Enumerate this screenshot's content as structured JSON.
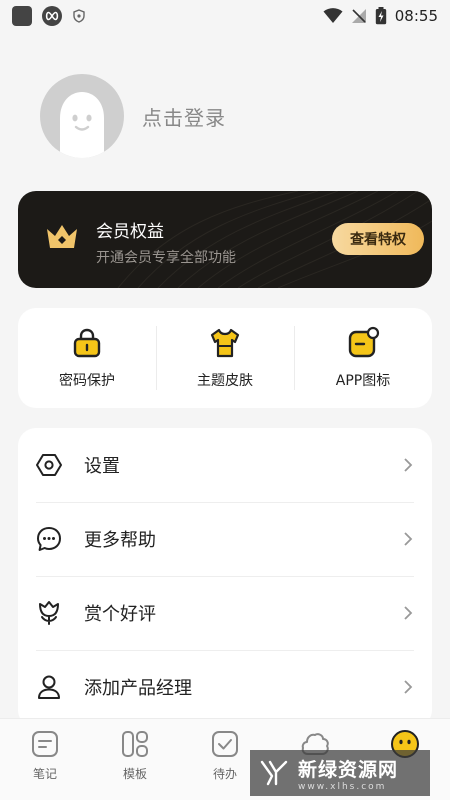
{
  "status_bar": {
    "time": "08:55"
  },
  "profile": {
    "login_text": "点击登录"
  },
  "vip": {
    "title": "会员权益",
    "subtitle": "开通会员专享全部功能",
    "button": "查看特权"
  },
  "quick_actions": [
    {
      "label": "密码保护",
      "icon": "lock-icon"
    },
    {
      "label": "主题皮肤",
      "icon": "shirt-icon"
    },
    {
      "label": "APP图标",
      "icon": "app-icon"
    }
  ],
  "menu": [
    {
      "label": "设置",
      "icon": "settings-icon"
    },
    {
      "label": "更多帮助",
      "icon": "help-chat-icon"
    },
    {
      "label": "赏个好评",
      "icon": "tulip-icon"
    },
    {
      "label": "添加产品经理",
      "icon": "person-icon"
    }
  ],
  "tabs": [
    {
      "label": "笔记",
      "icon": "note-icon"
    },
    {
      "label": "模板",
      "icon": "template-icon"
    },
    {
      "label": "待办",
      "icon": "todo-icon"
    },
    {
      "label": "",
      "icon": "cloud-icon"
    },
    {
      "label": "",
      "icon": "smiley-icon"
    }
  ],
  "watermark": {
    "main": "新绿资源网",
    "sub": "www.xlhs.com"
  },
  "colors": {
    "accent": "#f5c518",
    "vip_bg": "#1c1a17",
    "vip_button": "#f0b95a"
  }
}
